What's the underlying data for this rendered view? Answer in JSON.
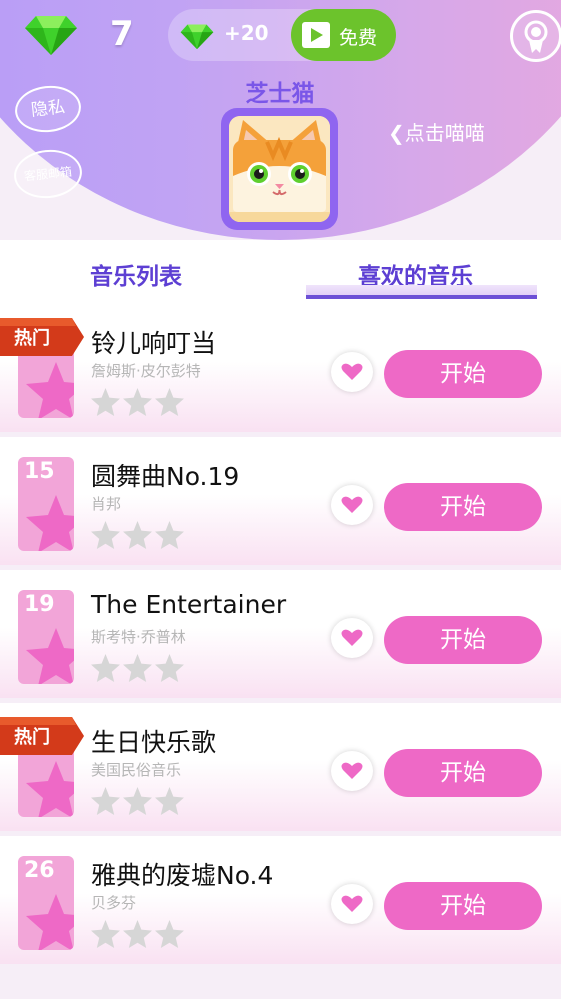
{
  "header": {
    "gem_count": "7",
    "reward_text": "+20",
    "free_label": "免费",
    "privacy_label": "隐私",
    "service_label": "客服邮箱",
    "cat_name": "芝士猫",
    "tap_cat_label": "❮点击喵喵",
    "icons": [
      "gem-icon",
      "video-icon",
      "badge-icon"
    ],
    "colors": {
      "accent": "#5d3fd3",
      "start": "#ee69c6",
      "free": "#6cc32c",
      "hot": "#d33a1a"
    }
  },
  "tabs": [
    {
      "label": "音乐列表",
      "active": false
    },
    {
      "label": "喜欢的音乐",
      "active": true
    }
  ],
  "songs": [
    {
      "number": "",
      "hot": "热门",
      "title": "铃儿响叮当",
      "artist": "詹姆斯·皮尔彭特",
      "stars": 0,
      "start": "开始"
    },
    {
      "number": "15",
      "hot": "",
      "title": "圆舞曲No.19",
      "artist": "肖邦",
      "stars": 0,
      "start": "开始"
    },
    {
      "number": "19",
      "hot": "",
      "title": "The Entertainer",
      "artist": "斯考特·乔普林",
      "stars": 0,
      "start": "开始"
    },
    {
      "number": "",
      "hot": "热门",
      "title": "生日快乐歌",
      "artist": "美国民俗音乐",
      "stars": 0,
      "start": "开始"
    },
    {
      "number": "26",
      "hot": "",
      "title": "雅典的废墟No.4",
      "artist": "贝多芬",
      "stars": 0,
      "start": "开始"
    }
  ]
}
